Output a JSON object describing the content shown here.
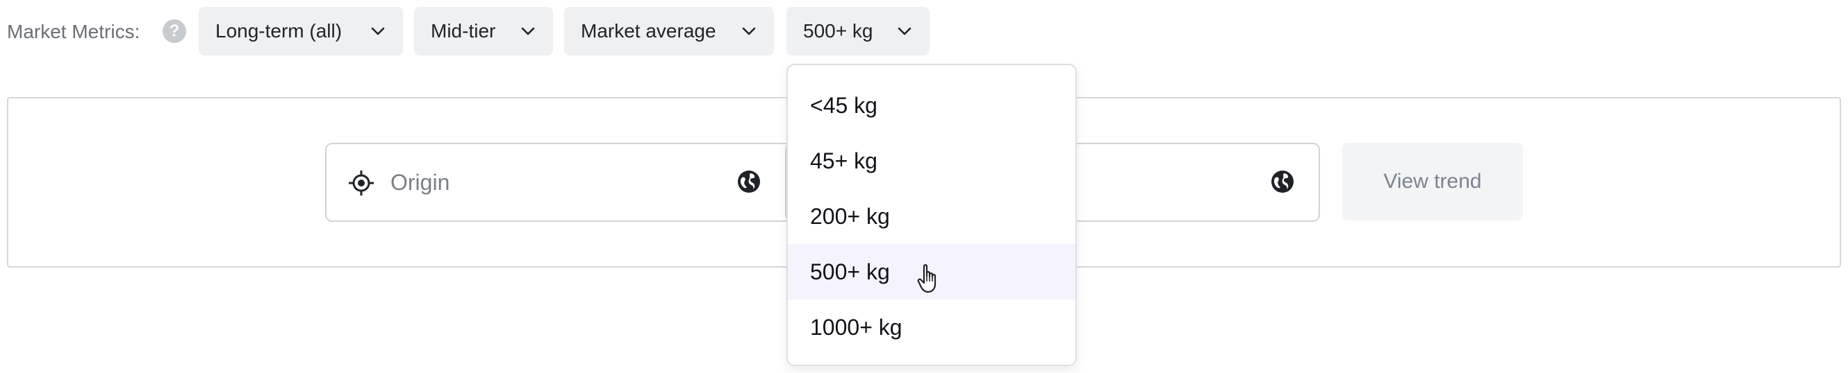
{
  "header": {
    "label": "Market Metrics:",
    "help_icon": "question-circle-icon",
    "filters": [
      {
        "label": "Long-term (all)",
        "icon": "chevron-down-icon"
      },
      {
        "label": "Mid-tier",
        "icon": "chevron-down-icon"
      },
      {
        "label": "Market average",
        "icon": "chevron-down-icon"
      },
      {
        "label": "500+ kg",
        "icon": "chevron-down-icon"
      }
    ]
  },
  "search": {
    "origin_placeholder": "Origin",
    "origin_icon": "crosshair-icon",
    "globe_icon": "globe-icon",
    "destination_placeholder": "",
    "submit_label": "View trend"
  },
  "weight_dropdown": {
    "options": [
      "<45 kg",
      "45+ kg",
      "200+ kg",
      "500+ kg",
      "1000+ kg"
    ],
    "selected": "500+ kg"
  },
  "colors": {
    "pill_bg": "#eef0f2",
    "selected_bg": "#f5f3fe",
    "muted_text": "#7b7f86",
    "border": "#d0d3d7"
  }
}
